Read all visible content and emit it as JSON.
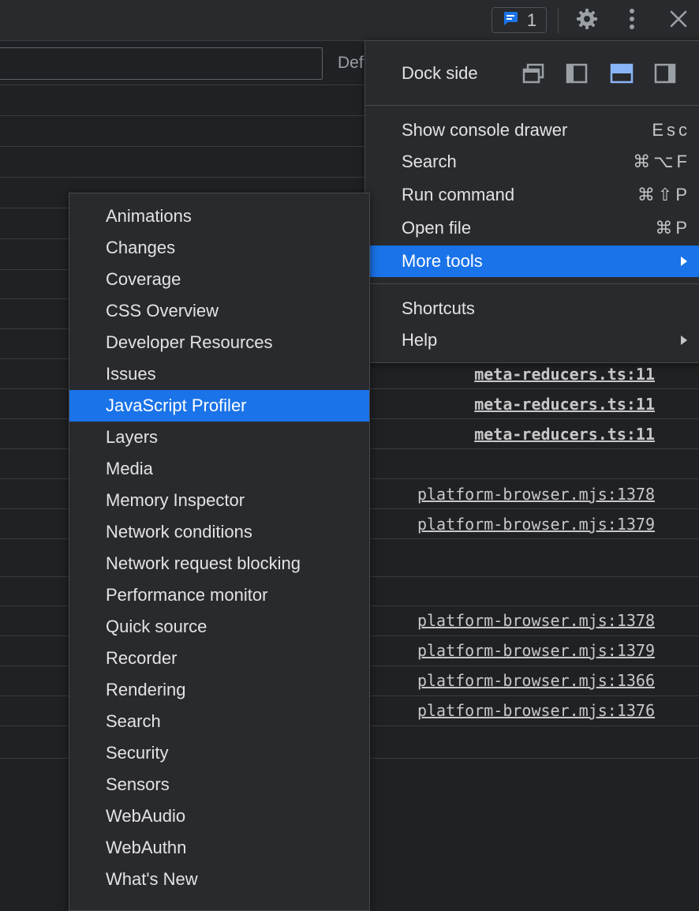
{
  "toolbar": {
    "issues_count": "1",
    "icons": [
      "issues-chat-icon",
      "gear-icon",
      "kebab-menu-icon",
      "close-icon"
    ]
  },
  "console": {
    "levels_label": "Def",
    "source_links": [
      {
        "text": "meta-reducers.ts:11",
        "bold": true
      },
      {
        "text": "meta-reducers.ts:11",
        "bold": true
      },
      {
        "text": "meta-reducers.ts:11",
        "bold": true
      },
      {
        "text": "platform-browser.mjs:1378",
        "bold": false
      },
      {
        "text": "platform-browser.mjs:1379",
        "bold": false
      },
      {
        "text": "platform-browser.mjs:1378",
        "bold": false
      },
      {
        "text": "platform-browser.mjs:1379",
        "bold": false
      },
      {
        "text": "platform-browser.mjs:1366",
        "bold": false
      },
      {
        "text": "platform-browser.mjs:1376",
        "bold": false
      }
    ]
  },
  "main_menu": {
    "dock_side_label": "Dock side",
    "dock_options": [
      "undock-icon",
      "dock-left-icon",
      "dock-bottom-icon",
      "dock-right-icon"
    ],
    "selected_dock": "dock-bottom-icon",
    "items": [
      {
        "label": "Show console drawer",
        "shortcut": "Esc"
      },
      {
        "label": "Search",
        "shortcut": "⌘⌥F"
      },
      {
        "label": "Run command",
        "shortcut": "⌘⇧P"
      },
      {
        "label": "Open file",
        "shortcut": "⌘P"
      },
      {
        "label": "More tools",
        "shortcut": "",
        "submenu": true,
        "highlighted": true
      },
      {
        "label": "Shortcuts",
        "shortcut": ""
      },
      {
        "label": "Help",
        "shortcut": "",
        "submenu": true
      }
    ]
  },
  "more_tools_menu": {
    "highlighted": "JavaScript Profiler",
    "items": [
      "Animations",
      "Changes",
      "Coverage",
      "CSS Overview",
      "Developer Resources",
      "Issues",
      "JavaScript Profiler",
      "Layers",
      "Media",
      "Memory Inspector",
      "Network conditions",
      "Network request blocking",
      "Performance monitor",
      "Quick source",
      "Recorder",
      "Rendering",
      "Search",
      "Security",
      "Sensors",
      "WebAudio",
      "WebAuthn",
      "What's New"
    ]
  },
  "colors": {
    "accent": "#1a73e8",
    "background": "#202124",
    "menu_background": "#292a2d"
  }
}
